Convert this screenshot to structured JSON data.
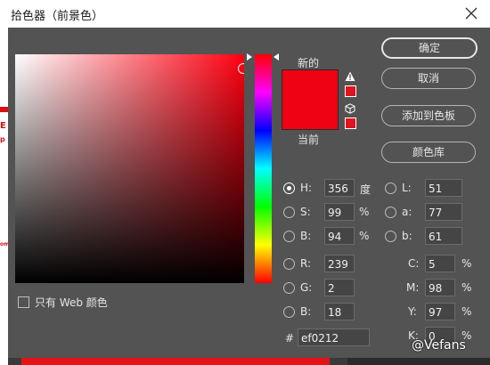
{
  "window": {
    "title": "拾色器（前景色）"
  },
  "preview": {
    "new_label": "新的",
    "current_label": "当前",
    "color_new": "#ef0212",
    "color_current": "#ef0212",
    "warning_icon": "warning-triangle-icon",
    "websafe_icon": "cube-icon"
  },
  "buttons": {
    "ok": "确定",
    "cancel": "取消",
    "add_swatch": "添加到色板",
    "color_libraries": "颜色库"
  },
  "hsb": {
    "h": {
      "label": "H:",
      "value": "356",
      "unit": "度",
      "selected": true
    },
    "s": {
      "label": "S:",
      "value": "99",
      "unit": "%"
    },
    "b": {
      "label": "B:",
      "value": "94",
      "unit": "%"
    }
  },
  "lab": {
    "l": {
      "label": "L:",
      "value": "51"
    },
    "a": {
      "label": "a:",
      "value": "77"
    },
    "b": {
      "label": "b:",
      "value": "61"
    }
  },
  "rgb": {
    "r": {
      "label": "R:",
      "value": "239"
    },
    "g": {
      "label": "G:",
      "value": "2"
    },
    "b": {
      "label": "B:",
      "value": "18"
    }
  },
  "cmyk": {
    "c": {
      "label": "C:",
      "value": "5",
      "unit": "%"
    },
    "m": {
      "label": "M:",
      "value": "98",
      "unit": "%"
    },
    "y": {
      "label": "Y:",
      "value": "97",
      "unit": "%"
    },
    "k": {
      "label": "K:",
      "value": "0",
      "unit": "%"
    }
  },
  "hex": {
    "label": "#",
    "value": "ef0212"
  },
  "web_only": {
    "label": "只有 Web 颜色",
    "checked": false
  },
  "watermark": "@Vefans",
  "backdrop": {
    "text_a": "E",
    "text_b": "p",
    "text_c": "om"
  }
}
